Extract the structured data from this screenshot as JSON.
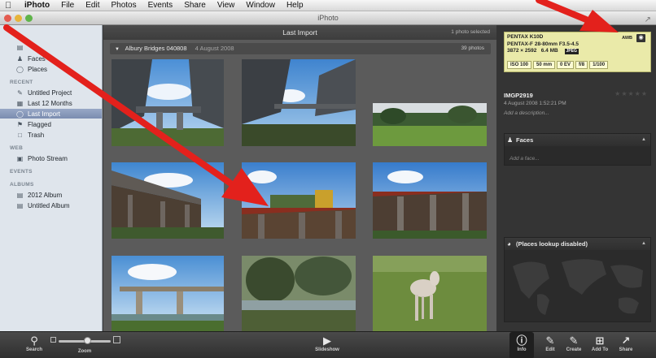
{
  "menubar": {
    "app_name": "iPhoto",
    "items": [
      "File",
      "Edit",
      "Photos",
      "Events",
      "Share",
      "View",
      "Window",
      "Help"
    ]
  },
  "window": {
    "title": "iPhoto"
  },
  "sidebar": {
    "library_items": [
      {
        "label": "Faces",
        "icon": "faces-icon"
      },
      {
        "label": "Places",
        "icon": "places-icon"
      }
    ],
    "recent_heading": "RECENT",
    "recent_items": [
      {
        "label": "Untitled Project",
        "icon": "project-icon"
      },
      {
        "label": "Last 12 Months",
        "icon": "calendar-icon"
      },
      {
        "label": "Last Import",
        "icon": "import-icon",
        "selected": true
      },
      {
        "label": "Flagged",
        "icon": "flag-icon"
      },
      {
        "label": "Trash",
        "icon": "trash-icon"
      }
    ],
    "web_heading": "WEB",
    "web_items": [
      {
        "label": "Photo Stream",
        "icon": "photo-stream-icon"
      }
    ],
    "events_heading": "EVENTS",
    "albums_heading": "ALBUMS",
    "album_items": [
      {
        "label": "2012 Album",
        "icon": "album-icon"
      },
      {
        "label": "Untitled Album",
        "icon": "album-icon"
      }
    ]
  },
  "main": {
    "title": "Last Import",
    "status": "1 photo selected",
    "event": {
      "name": "Albury Bridges 040808",
      "date": "4 August 2008",
      "count": "39 photos"
    }
  },
  "info": {
    "camera": "PENTAX K10D",
    "lens": "PENTAX-F 28-80mm F3.5-4.5",
    "dimensions": "3872 × 2592",
    "size": "6.4 MB",
    "format": "JPEG",
    "flash_label": "AWB",
    "stats": [
      "ISO 100",
      "50 mm",
      "0 EV",
      "f/8",
      "1/100"
    ],
    "photo_name": "IMGP2919",
    "photo_date": "4 August 2008 1:52:21 PM",
    "description_placeholder": "Add a description...",
    "faces_title": "Faces",
    "faces_placeholder": "Add a face...",
    "places_title": "(Places lookup disabled)"
  },
  "toolbar": {
    "search": "Search",
    "zoom": "Zoom",
    "slideshow": "Slideshow",
    "info": "Info",
    "edit": "Edit",
    "create": "Create",
    "add_to": "Add To",
    "share": "Share"
  },
  "colors": {
    "selection": "#f0c62c",
    "annotation_arrow": "#e3211c",
    "exif_bg": "#eaeaa9"
  }
}
